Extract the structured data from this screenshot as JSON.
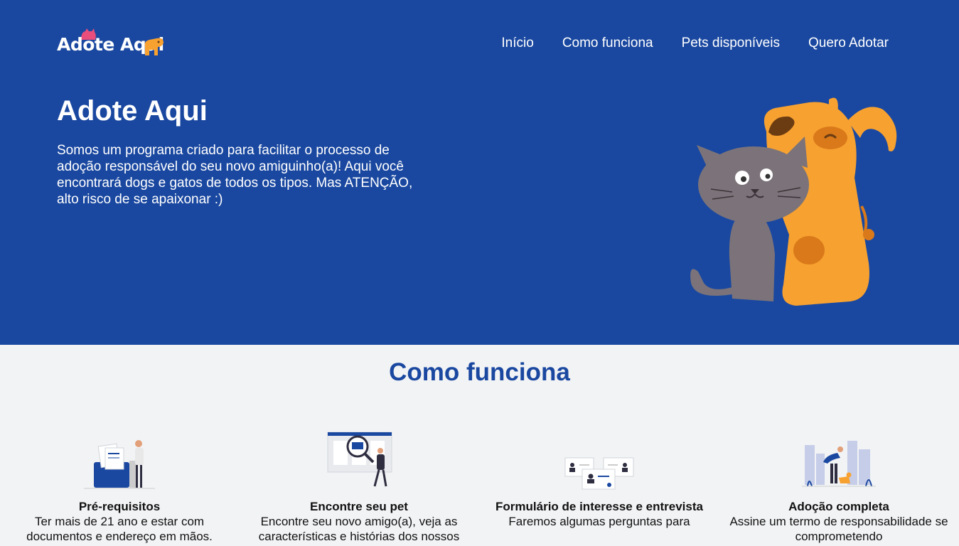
{
  "logo": {
    "text": "Adote Aqui"
  },
  "nav": {
    "items": [
      {
        "label": "Início"
      },
      {
        "label": "Como funciona"
      },
      {
        "label": "Pets disponíveis"
      },
      {
        "label": "Quero Adotar"
      }
    ]
  },
  "hero": {
    "title": "Adote Aqui",
    "description": "Somos um programa criado para facilitar o processo de adoção responsável do seu novo amiguinho(a)! Aqui você encontrará dogs e gatos de todos os tipos. Mas ATENÇÃO, alto risco de se apaixonar :)"
  },
  "how": {
    "title": "Como funciona",
    "steps": [
      {
        "title": "Pré-requisitos",
        "text": "Ter mais de 21 ano e estar com documentos e endereço em mãos."
      },
      {
        "title": "Encontre seu pet",
        "text": "Encontre seu novo amigo(a), veja as características e histórias dos nossos"
      },
      {
        "title": "Formulário de interesse e entrevista",
        "text": "Faremos algumas perguntas para"
      },
      {
        "title": "Adoção completa",
        "text": "Assine um termo de responsabilidade se comprometendo"
      }
    ]
  },
  "colors": {
    "primary": "#1a48a0",
    "background": "#f2f3f5",
    "dog": "#f7a130",
    "cat": "#7b7379"
  }
}
